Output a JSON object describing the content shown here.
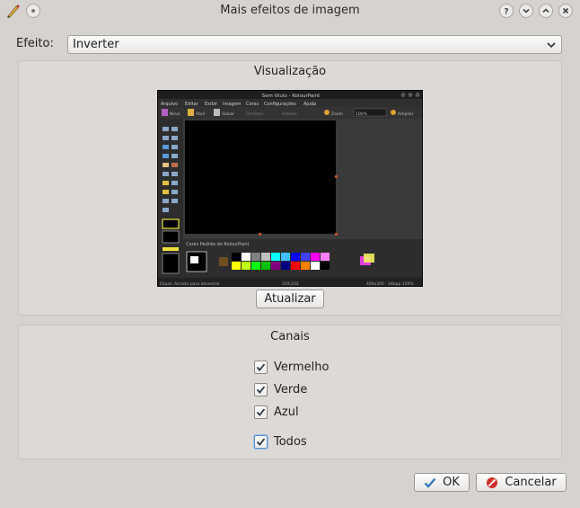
{
  "window": {
    "title": "Mais efeitos de imagem"
  },
  "effect": {
    "label": "Efeito:",
    "value": "Inverter"
  },
  "preview": {
    "title": "Visualização",
    "update_button": "Atualizar",
    "thumb": {
      "title": "Sem título - KolourPaint",
      "menu": [
        "Arquivo",
        "Editar",
        "Exibir",
        "Imagem",
        "Cores",
        "Configurações",
        "Ajuda"
      ],
      "toolbar": [
        "Novo",
        "Abrir",
        "Salvar",
        "Desfazer",
        "Refazer",
        "Zoom",
        "Ampliar"
      ],
      "zoom": "100%",
      "palette_label": "Cores Padrão do KolourPaint",
      "status_left": "Elipse: Arraste para desenhar",
      "status_mid": "319,232",
      "status_right": "400x300 · 24bpp 100%",
      "palette_colors": [
        "#000000",
        "#ffffff",
        "#808080",
        "#c0c0c0",
        "#00ffff",
        "#40c0ff",
        "#0000ff",
        "#4040ff",
        "#ff00ff",
        "#ff80ff",
        "#ffff00",
        "#c0ff00",
        "#00ff00",
        "#00c000",
        "#800080",
        "#000080",
        "#ff0000",
        "#ff8000",
        "#ffffff",
        "#000000"
      ]
    }
  },
  "channels": {
    "title": "Canais",
    "items": [
      {
        "label": "Vermelho",
        "checked": true
      },
      {
        "label": "Verde",
        "checked": true
      },
      {
        "label": "Azul",
        "checked": true
      },
      {
        "label": "Todos",
        "checked": true
      }
    ]
  },
  "buttons": {
    "ok": "OK",
    "cancel": "Cancelar"
  },
  "colors": {
    "accent": "#3a78c0",
    "cancel_red": "#d0302a",
    "check_blue": "#28588f"
  }
}
